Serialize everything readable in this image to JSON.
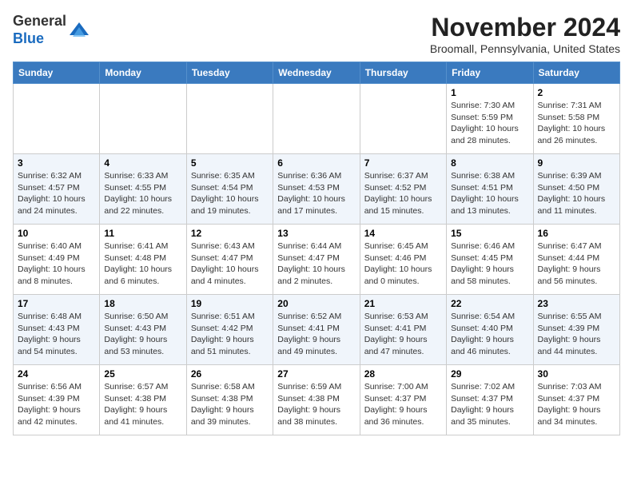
{
  "logo": {
    "general": "General",
    "blue": "Blue"
  },
  "header": {
    "month": "November 2024",
    "location": "Broomall, Pennsylvania, United States"
  },
  "weekdays": [
    "Sunday",
    "Monday",
    "Tuesday",
    "Wednesday",
    "Thursday",
    "Friday",
    "Saturday"
  ],
  "weeks": [
    [
      {
        "day": "",
        "info": ""
      },
      {
        "day": "",
        "info": ""
      },
      {
        "day": "",
        "info": ""
      },
      {
        "day": "",
        "info": ""
      },
      {
        "day": "",
        "info": ""
      },
      {
        "day": "1",
        "info": "Sunrise: 7:30 AM\nSunset: 5:59 PM\nDaylight: 10 hours\nand 28 minutes."
      },
      {
        "day": "2",
        "info": "Sunrise: 7:31 AM\nSunset: 5:58 PM\nDaylight: 10 hours\nand 26 minutes."
      }
    ],
    [
      {
        "day": "3",
        "info": "Sunrise: 6:32 AM\nSunset: 4:57 PM\nDaylight: 10 hours\nand 24 minutes."
      },
      {
        "day": "4",
        "info": "Sunrise: 6:33 AM\nSunset: 4:55 PM\nDaylight: 10 hours\nand 22 minutes."
      },
      {
        "day": "5",
        "info": "Sunrise: 6:35 AM\nSunset: 4:54 PM\nDaylight: 10 hours\nand 19 minutes."
      },
      {
        "day": "6",
        "info": "Sunrise: 6:36 AM\nSunset: 4:53 PM\nDaylight: 10 hours\nand 17 minutes."
      },
      {
        "day": "7",
        "info": "Sunrise: 6:37 AM\nSunset: 4:52 PM\nDaylight: 10 hours\nand 15 minutes."
      },
      {
        "day": "8",
        "info": "Sunrise: 6:38 AM\nSunset: 4:51 PM\nDaylight: 10 hours\nand 13 minutes."
      },
      {
        "day": "9",
        "info": "Sunrise: 6:39 AM\nSunset: 4:50 PM\nDaylight: 10 hours\nand 11 minutes."
      }
    ],
    [
      {
        "day": "10",
        "info": "Sunrise: 6:40 AM\nSunset: 4:49 PM\nDaylight: 10 hours\nand 8 minutes."
      },
      {
        "day": "11",
        "info": "Sunrise: 6:41 AM\nSunset: 4:48 PM\nDaylight: 10 hours\nand 6 minutes."
      },
      {
        "day": "12",
        "info": "Sunrise: 6:43 AM\nSunset: 4:47 PM\nDaylight: 10 hours\nand 4 minutes."
      },
      {
        "day": "13",
        "info": "Sunrise: 6:44 AM\nSunset: 4:47 PM\nDaylight: 10 hours\nand 2 minutes."
      },
      {
        "day": "14",
        "info": "Sunrise: 6:45 AM\nSunset: 4:46 PM\nDaylight: 10 hours\nand 0 minutes."
      },
      {
        "day": "15",
        "info": "Sunrise: 6:46 AM\nSunset: 4:45 PM\nDaylight: 9 hours\nand 58 minutes."
      },
      {
        "day": "16",
        "info": "Sunrise: 6:47 AM\nSunset: 4:44 PM\nDaylight: 9 hours\nand 56 minutes."
      }
    ],
    [
      {
        "day": "17",
        "info": "Sunrise: 6:48 AM\nSunset: 4:43 PM\nDaylight: 9 hours\nand 54 minutes."
      },
      {
        "day": "18",
        "info": "Sunrise: 6:50 AM\nSunset: 4:43 PM\nDaylight: 9 hours\nand 53 minutes."
      },
      {
        "day": "19",
        "info": "Sunrise: 6:51 AM\nSunset: 4:42 PM\nDaylight: 9 hours\nand 51 minutes."
      },
      {
        "day": "20",
        "info": "Sunrise: 6:52 AM\nSunset: 4:41 PM\nDaylight: 9 hours\nand 49 minutes."
      },
      {
        "day": "21",
        "info": "Sunrise: 6:53 AM\nSunset: 4:41 PM\nDaylight: 9 hours\nand 47 minutes."
      },
      {
        "day": "22",
        "info": "Sunrise: 6:54 AM\nSunset: 4:40 PM\nDaylight: 9 hours\nand 46 minutes."
      },
      {
        "day": "23",
        "info": "Sunrise: 6:55 AM\nSunset: 4:39 PM\nDaylight: 9 hours\nand 44 minutes."
      }
    ],
    [
      {
        "day": "24",
        "info": "Sunrise: 6:56 AM\nSunset: 4:39 PM\nDaylight: 9 hours\nand 42 minutes."
      },
      {
        "day": "25",
        "info": "Sunrise: 6:57 AM\nSunset: 4:38 PM\nDaylight: 9 hours\nand 41 minutes."
      },
      {
        "day": "26",
        "info": "Sunrise: 6:58 AM\nSunset: 4:38 PM\nDaylight: 9 hours\nand 39 minutes."
      },
      {
        "day": "27",
        "info": "Sunrise: 6:59 AM\nSunset: 4:38 PM\nDaylight: 9 hours\nand 38 minutes."
      },
      {
        "day": "28",
        "info": "Sunrise: 7:00 AM\nSunset: 4:37 PM\nDaylight: 9 hours\nand 36 minutes."
      },
      {
        "day": "29",
        "info": "Sunrise: 7:02 AM\nSunset: 4:37 PM\nDaylight: 9 hours\nand 35 minutes."
      },
      {
        "day": "30",
        "info": "Sunrise: 7:03 AM\nSunset: 4:37 PM\nDaylight: 9 hours\nand 34 minutes."
      }
    ]
  ]
}
